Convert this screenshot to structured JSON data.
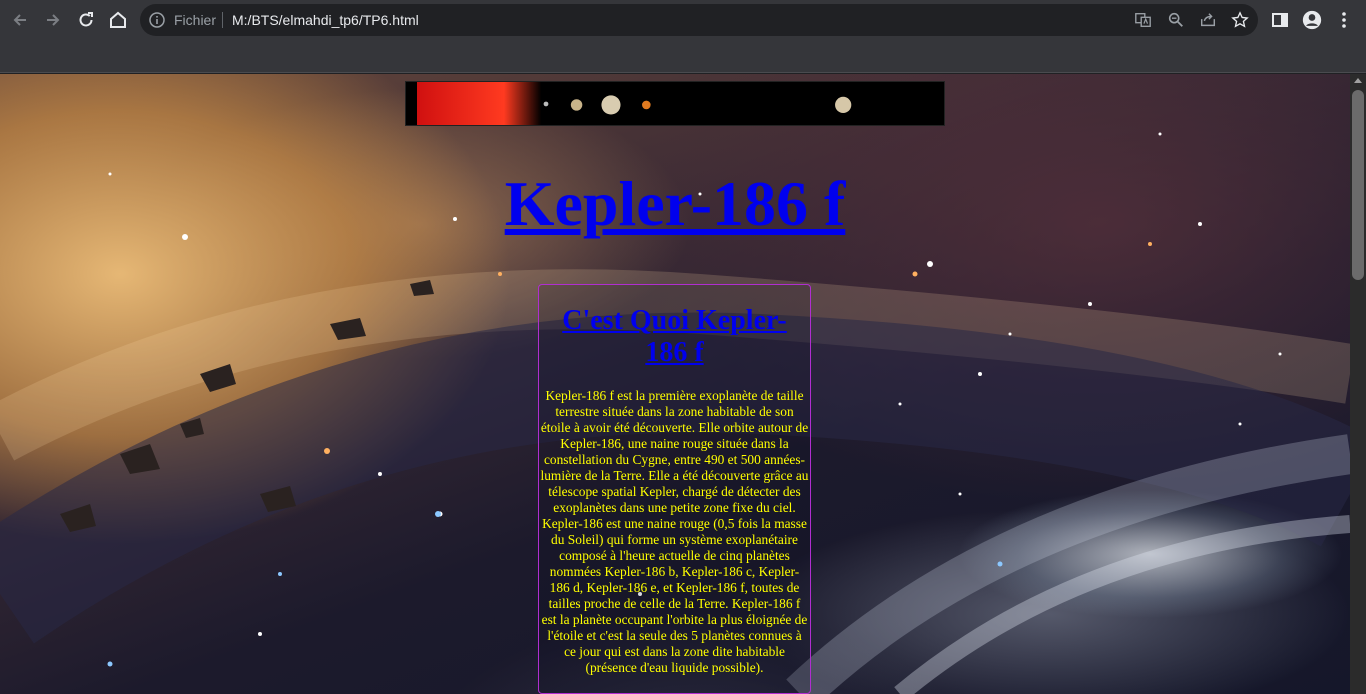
{
  "browser": {
    "address_scheme": "Fichier",
    "address_url": "M:/BTS/elmahdi_tp6/TP6.html",
    "icons": [
      "back-icon",
      "forward-icon",
      "reload-icon",
      "home-icon",
      "info-icon",
      "translate-icon",
      "zoom-icon",
      "share-icon",
      "bookmark-star-icon",
      "side-panel-icon",
      "profile-icon",
      "menu-icon"
    ]
  },
  "page": {
    "title": "Kepler-186 f",
    "section_title": "C'est Quoi Kepler-186 f",
    "section_text": "Kepler-186 f est la première exoplanète de taille terrestre située dans la zone habitable de son étoile à avoir été découverte. Elle orbite autour de Kepler-186, une naine rouge située dans la constellation du Cygne, entre 490 et 500 années-lumière de la Terre. Elle a été découverte grâce au télescope spatial Kepler, chargé de détecter des exoplanètes dans une petite zone fixe du ciel. Kepler-186 est une naine rouge (0,5 fois la masse du Soleil) qui forme un système exoplanétaire composé à l'heure actuelle de cinq planètes nommées Kepler-186 b, Kepler-186 c, Kepler-186 d, Kepler-186 e, et Kepler-186 f, toutes de tailles proche de celle de la Terre. Kepler-186 f est la planète occupant l'orbite la plus éloignée de l'étoile et c'est la seule des 5 planètes connues à ce jour qui est dans la zone dite habitable (présence d'eau liquide possible)."
  },
  "colors": {
    "link": "#0000ee",
    "body_text": "#ffff00",
    "box_border": "#b02ed0",
    "chrome": "#35363a"
  }
}
